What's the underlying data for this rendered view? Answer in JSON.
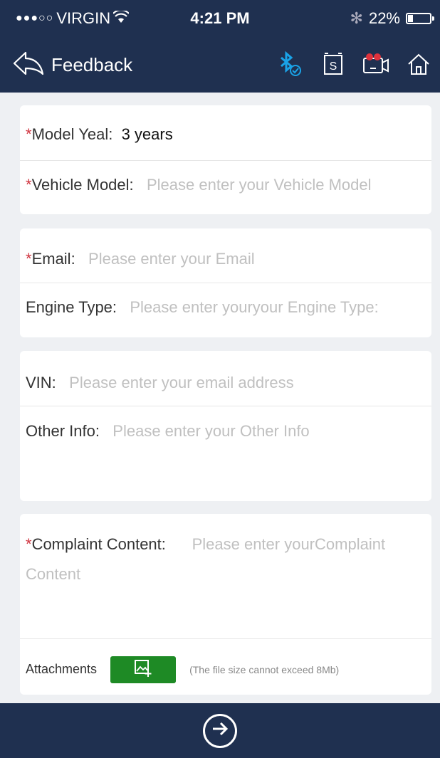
{
  "status": {
    "signal": "●●●○○",
    "carrier": "VIRGIN",
    "time": "4:21 PM",
    "bluetooth": "✻",
    "battery": "22%"
  },
  "nav": {
    "title": "Feedback",
    "icons": [
      "bluetooth-check-icon",
      "s-box-icon",
      "camera-record-icon",
      "home-icon"
    ],
    "s_letter": "S"
  },
  "form": {
    "required_mark": "*",
    "model_year": {
      "label": "Model Yeal:",
      "value": "3 years"
    },
    "vehicle_model": {
      "label": "Vehicle Model:",
      "placeholder": "Please enter your Vehicle Model"
    },
    "email": {
      "label": "Email:",
      "placeholder": "Please enter your Email"
    },
    "engine_type": {
      "label": "Engine Type:",
      "placeholder": "Please enter youryour Engine Type:"
    },
    "vin": {
      "label": "VIN:",
      "placeholder": "Please enter your email address"
    },
    "other_info": {
      "label": "Other Info:",
      "placeholder": "Please enter your Other Info"
    },
    "complaint": {
      "label": "Complaint Content:",
      "placeholder_line1": "Please enter yourComplaint",
      "placeholder_line2": "Content"
    },
    "attachments": {
      "label": "Attachments",
      "hint": "(The file size cannot exceed 8Mb)"
    }
  },
  "colors": {
    "bar": "#1f3050",
    "required": "#d0343f",
    "accent": "#1e8a25",
    "bluetooth": "#1aa3e8"
  }
}
